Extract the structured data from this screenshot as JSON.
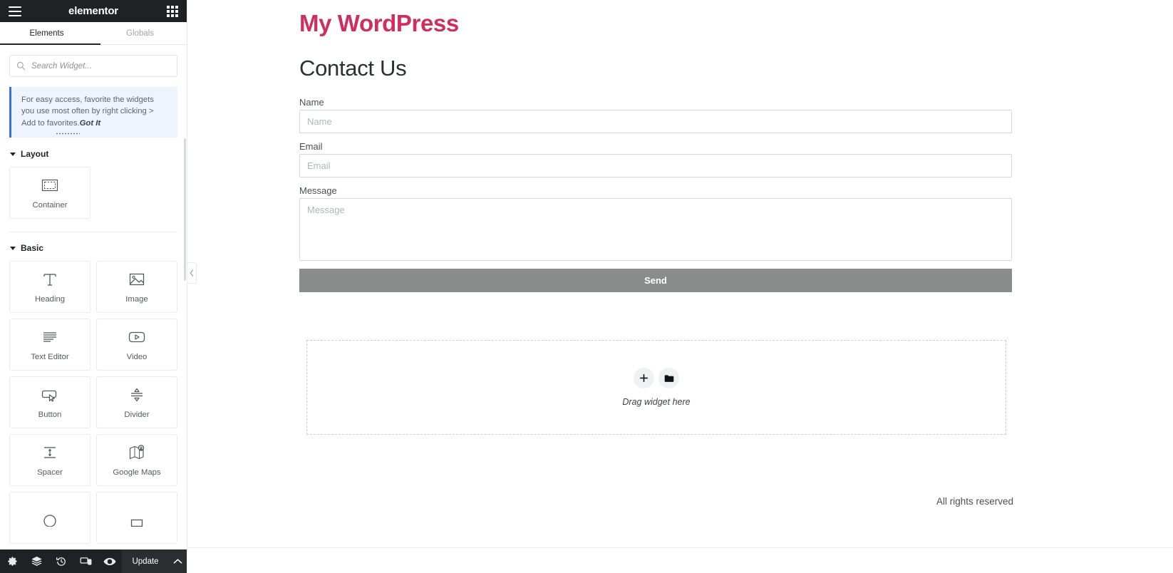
{
  "panel": {
    "brand": "elementor",
    "menu_icon": "hamburger-icon",
    "apps_icon": "grid-apps-icon",
    "tabs": [
      {
        "label": "Elements",
        "active": true
      },
      {
        "label": "Globals",
        "active": false
      }
    ],
    "search": {
      "placeholder": "Search Widget...",
      "value": "",
      "icon": "search-icon"
    },
    "notice": {
      "text": "For easy access, favorite the widgets you use most often by right clicking > Add to favorites.",
      "cta": "Got It"
    },
    "categories": [
      {
        "title": "Layout",
        "widgets": [
          {
            "label": "Container",
            "icon": "container-icon"
          }
        ]
      },
      {
        "title": "Basic",
        "widgets": [
          {
            "label": "Heading",
            "icon": "heading-icon"
          },
          {
            "label": "Image",
            "icon": "image-icon"
          },
          {
            "label": "Text Editor",
            "icon": "text-editor-icon"
          },
          {
            "label": "Video",
            "icon": "video-icon"
          },
          {
            "label": "Button",
            "icon": "button-icon"
          },
          {
            "label": "Divider",
            "icon": "divider-icon"
          },
          {
            "label": "Spacer",
            "icon": "spacer-icon"
          },
          {
            "label": "Google Maps",
            "icon": "google-maps-icon"
          }
        ]
      }
    ],
    "footer": {
      "settings_icon": "gear-icon",
      "navigator_icon": "layers-icon",
      "history_icon": "history-icon",
      "responsive_icon": "responsive-devices-icon",
      "preview_icon": "eye-icon",
      "update_label": "Update",
      "update_caret_icon": "chevron-up-icon"
    },
    "collapse_icon": "chevron-left-icon"
  },
  "canvas": {
    "site_title": "My WordPress",
    "page_heading": "Contact Us",
    "form": {
      "fields": [
        {
          "label": "Name",
          "placeholder": "Name",
          "value": "",
          "type": "text"
        },
        {
          "label": "Email",
          "placeholder": "Email",
          "value": "",
          "type": "text"
        },
        {
          "label": "Message",
          "placeholder": "Message",
          "value": "",
          "type": "textarea"
        }
      ],
      "submit_label": "Send"
    },
    "dropzone": {
      "add_icon": "plus-icon",
      "folder_icon": "folder-icon",
      "label": "Drag widget here"
    },
    "footer_note": "All rights reserved"
  },
  "colors": {
    "brand_dark": "#1f2124",
    "site_title": "#cf2e5f",
    "tab_active_underline": "#1f2124",
    "notice_accent": "#3f6fd8",
    "send_button": "#8a8c8c"
  }
}
